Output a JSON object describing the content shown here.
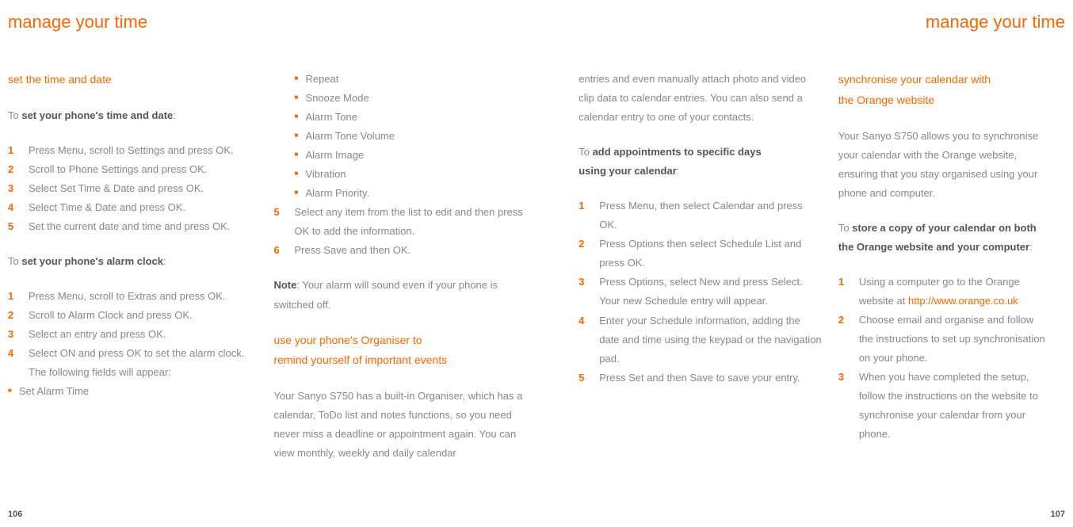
{
  "header": {
    "left": "manage your time",
    "right": "manage your time"
  },
  "col1": {
    "section1_title": "set the time and date",
    "intro1_prefix": "To ",
    "intro1_bold": "set your phone's time and date",
    "intro1_suffix": ":",
    "steps1": [
      "Press Menu, scroll to Settings and press OK.",
      "Scroll to Phone Settings and press OK.",
      "Select Set Time & Date and press OK.",
      "Select Time & Date and press OK.",
      "Set the current date and time and press OK."
    ],
    "intro2_prefix": "To ",
    "intro2_bold": "set your phone's alarm clock",
    "intro2_suffix": ":",
    "steps2": [
      "Press Menu, scroll to Extras and press OK.",
      "Scroll to Alarm Clock and press OK.",
      "Select an entry and press OK.",
      "Select ON and press OK to set the alarm clock. The following fields will appear:"
    ],
    "sub_item": "Set Alarm Time"
  },
  "col2": {
    "bullets": [
      "Repeat",
      "Snooze Mode",
      "Alarm Tone",
      "Alarm Tone Volume",
      "Alarm Image",
      "Vibration",
      "Alarm Priority."
    ],
    "step5": "Select any item from the list to edit and then press OK to add the information.",
    "step6": "Press Save and then OK.",
    "note_label": "Note",
    "note_text": ": Your alarm will sound even if your phone is switched off.",
    "section2_title_l1": "use your phone's Organiser to",
    "section2_title_l2": "remind yourself of important events",
    "para": "Your Sanyo S750 has a built-in Organiser, which has a calendar, ToDo list and notes functions, so you need never miss a deadline or appointment again. You can view monthly, weekly and daily calendar"
  },
  "col3": {
    "para_cont": "entries and even manually attach photo and video clip data to calendar entries. You can also send a calendar entry to one of your contacts.",
    "intro_prefix": "To ",
    "intro_bold_l1": "add appointments to specific days",
    "intro_bold_l2": "using your calendar",
    "intro_suffix": ":",
    "steps": [
      "Press Menu, then select Calendar and press OK.",
      "Press Options then select Schedule List and press OK.",
      "Press Options, select New and press Select. Your new Schedule entry will appear.",
      "Enter your Schedule information, adding the date and time using the keypad or the navigation pad.",
      "Press Set and then Save to save your entry."
    ]
  },
  "col4": {
    "section_title_l1": "synchronise your calendar with",
    "section_title_l2": "the Orange website",
    "para": "Your Sanyo S750 allows you to synchronise your calendar with the Orange website, ensuring that you stay organised using your phone and computer.",
    "intro_prefix": "To ",
    "intro_bold_l1": "store a copy of your calendar on both",
    "intro_bold_l2": "the Orange website and your computer",
    "intro_suffix": ":",
    "step1_prefix": "Using a computer go to the Orange website at ",
    "step1_link": "http://www.orange.co.uk",
    "steps_rest": [
      "Choose email and organise and follow the instructions to set up synchronisation on your phone.",
      "When you have completed the setup, follow the instructions on the website to synchronise your calendar from your phone."
    ]
  },
  "page_left": "106",
  "page_right": "107"
}
